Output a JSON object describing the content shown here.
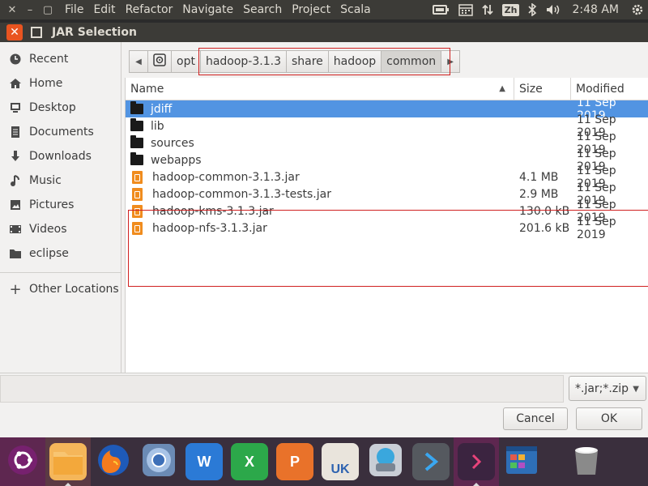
{
  "menubar": {
    "window_buttons": [
      "✕",
      "–",
      "▢"
    ],
    "menus": [
      "File",
      "Edit",
      "Refactor",
      "Navigate",
      "Search",
      "Project",
      "Scala"
    ],
    "indicators": {
      "input_method": "Zh",
      "clock": "2:48 AM"
    }
  },
  "dialog": {
    "title": "JAR Selection"
  },
  "sidebar": {
    "items": [
      {
        "label": "Recent",
        "icon": "clock-icon"
      },
      {
        "label": "Home",
        "icon": "home-icon"
      },
      {
        "label": "Desktop",
        "icon": "desktop-icon"
      },
      {
        "label": "Documents",
        "icon": "documents-icon"
      },
      {
        "label": "Downloads",
        "icon": "download-icon"
      },
      {
        "label": "Music",
        "icon": "music-icon"
      },
      {
        "label": "Pictures",
        "icon": "pictures-icon"
      },
      {
        "label": "Videos",
        "icon": "videos-icon"
      },
      {
        "label": "eclipse",
        "icon": "folder-icon"
      }
    ],
    "other_locations": "Other Locations"
  },
  "pathbar": {
    "segments": [
      "opt",
      "hadoop-3.1.3",
      "share",
      "hadoop",
      "common"
    ],
    "active": "common"
  },
  "filelist": {
    "columns": {
      "name": "Name",
      "size": "Size",
      "modified": "Modified"
    },
    "rows": [
      {
        "name": "jdiff",
        "size": "",
        "modified": "11 Sep 2019",
        "type": "folder"
      },
      {
        "name": "lib",
        "size": "",
        "modified": "11 Sep 2019",
        "type": "folder"
      },
      {
        "name": "sources",
        "size": "",
        "modified": "11 Sep 2019",
        "type": "folder"
      },
      {
        "name": "webapps",
        "size": "",
        "modified": "11 Sep 2019",
        "type": "folder"
      },
      {
        "name": "hadoop-common-3.1.3.jar",
        "size": "4.1 MB",
        "modified": "11 Sep 2019",
        "type": "jar"
      },
      {
        "name": "hadoop-common-3.1.3-tests.jar",
        "size": "2.9 MB",
        "modified": "11 Sep 2019",
        "type": "jar"
      },
      {
        "name": "hadoop-kms-3.1.3.jar",
        "size": "130.0 kB",
        "modified": "11 Sep 2019",
        "type": "jar"
      },
      {
        "name": "hadoop-nfs-3.1.3.jar",
        "size": "201.6 kB",
        "modified": "11 Sep 2019",
        "type": "jar"
      }
    ],
    "selected_row": "jdiff"
  },
  "filter": {
    "value": "*.jar;*.zip"
  },
  "buttons": {
    "cancel": "Cancel",
    "ok": "OK"
  },
  "dock": {
    "apps": [
      "ubuntu-logo-icon",
      "files-icon",
      "firefox-icon",
      "chromium-icon",
      "writer-icon",
      "calc-icon",
      "impress-icon",
      "software-center-icon",
      "update-icon",
      "vscode-icon",
      "terminal-icon",
      "workspace-icon",
      "trash-icon"
    ],
    "word_letter": "W",
    "calc_letter": "X",
    "impress_letter": "P",
    "uk_label": "UK"
  },
  "colors": {
    "accent": "#e95420",
    "selection": "#5294e2",
    "highlight_box": "#d02020"
  }
}
